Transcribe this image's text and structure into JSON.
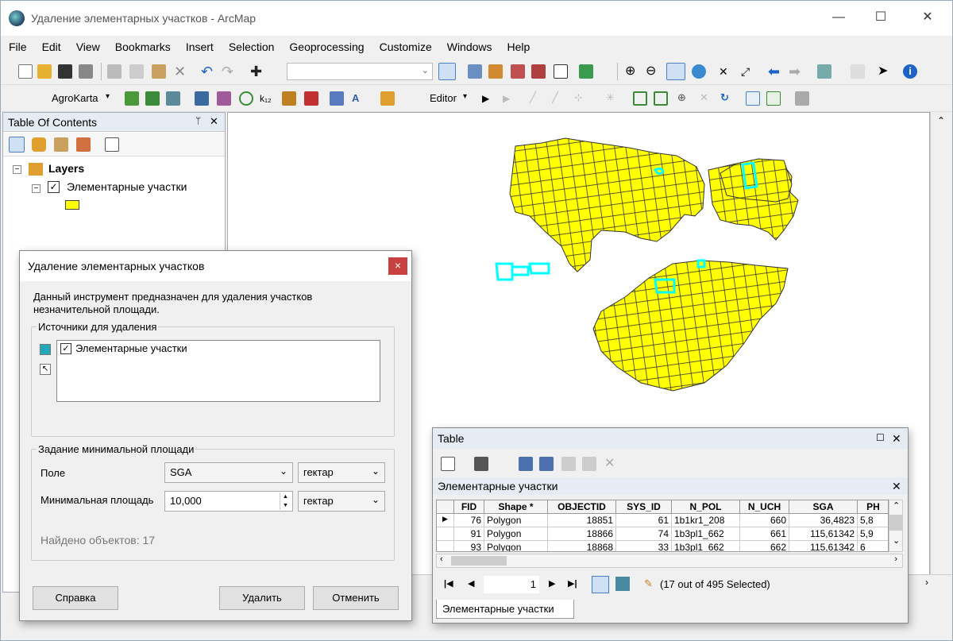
{
  "window": {
    "title": "Удаление элементарных участков - ArcMap",
    "minimize": "—",
    "maximize": "☐",
    "close": "✕"
  },
  "menu": [
    "File",
    "Edit",
    "View",
    "Bookmarks",
    "Insert",
    "Selection",
    "Geoprocessing",
    "Customize",
    "Windows",
    "Help"
  ],
  "toolbar2": {
    "agrokarta": "AgroKarta",
    "editor": "Editor"
  },
  "toc": {
    "title": "Table Of Contents",
    "pin": "ᛘ",
    "close": "✕",
    "layers_label": "Layers",
    "layer_name": "Элементарные участки"
  },
  "dialog": {
    "title": "Удаление элементарных участков",
    "close": "×",
    "description": "Данный инструмент предназначен для удаления участков незначительной площади.",
    "sources_legend": "Источники для удаления",
    "source_item": "Элементарные участки",
    "area_legend": "Задание минимальной площади",
    "field_label": "Поле",
    "field_value": "SGA",
    "field_unit": "гектар",
    "min_area_label": "Минимальная площадь",
    "min_area_value": "10,000",
    "min_area_unit": "гектар",
    "found": "Найдено объектов: 17",
    "help_button": "Справка",
    "delete_button": "Удалить",
    "cancel_button": "Отменить"
  },
  "table": {
    "title": "Table",
    "layer_tab": "Элементарные участки",
    "columns": [
      "FID",
      "Shape *",
      "OBJECTID",
      "SYS_ID",
      "N_POL",
      "N_UCH",
      "SGA",
      "PH"
    ],
    "rows": [
      [
        "76",
        "Polygon",
        "18851",
        "61",
        "1b1kr1_208",
        "660",
        "36,4823",
        "5,8"
      ],
      [
        "91",
        "Polygon",
        "18866",
        "74",
        "1b3pl1_662",
        "661",
        "115,61342",
        "5,9"
      ],
      [
        "93",
        "Polygon",
        "18868",
        "33",
        "1b3pl1_662",
        "662",
        "115,61342",
        "6"
      ]
    ],
    "record": "1",
    "status": "(17 out of 495 Selected)",
    "bottom_tab": "Элементарные участки"
  },
  "colors": {
    "polygon_fill": "#ffff00",
    "selected": "#00ffff",
    "accent": "#1e64c8"
  }
}
